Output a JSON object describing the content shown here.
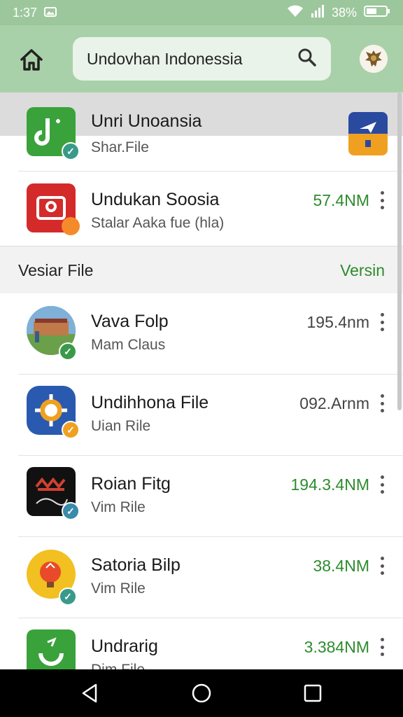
{
  "status": {
    "time": "1:37",
    "battery": "38%"
  },
  "header": {
    "search_text": "Undovhan Indonessia"
  },
  "top_items": [
    {
      "title": "Unri Unoansia",
      "subtitle": "Shar.File"
    },
    {
      "title": "Undukan Soosia",
      "subtitle": "Stalar Aaka fue (hla)",
      "size": "57.4NM"
    }
  ],
  "section": {
    "title": "Vesiar File",
    "link": "Versin"
  },
  "items": [
    {
      "title": "Vava Folp",
      "subtitle": "Mam Claus",
      "size": "195.4nm"
    },
    {
      "title": "Undihhona File",
      "subtitle": "Uian Rile",
      "size": "092.Arnm"
    },
    {
      "title": "Roian Fitg",
      "subtitle": "Vim Rile",
      "size": "194.3.4NM"
    },
    {
      "title": "Satoria Bilp",
      "subtitle": "Vim Rile",
      "size": "38.4NM"
    },
    {
      "title": "Undrarig",
      "subtitle": "Dim File",
      "size": "3.384NM"
    }
  ],
  "icons": {
    "status": [
      "image-icon",
      "wifi-icon",
      "signal-icon",
      "battery-icon"
    ],
    "nav": [
      "back-icon",
      "home-icon",
      "recents-icon"
    ]
  },
  "colors": {
    "accent": "#2e8b2e",
    "appbar": "#a9d1a9"
  }
}
